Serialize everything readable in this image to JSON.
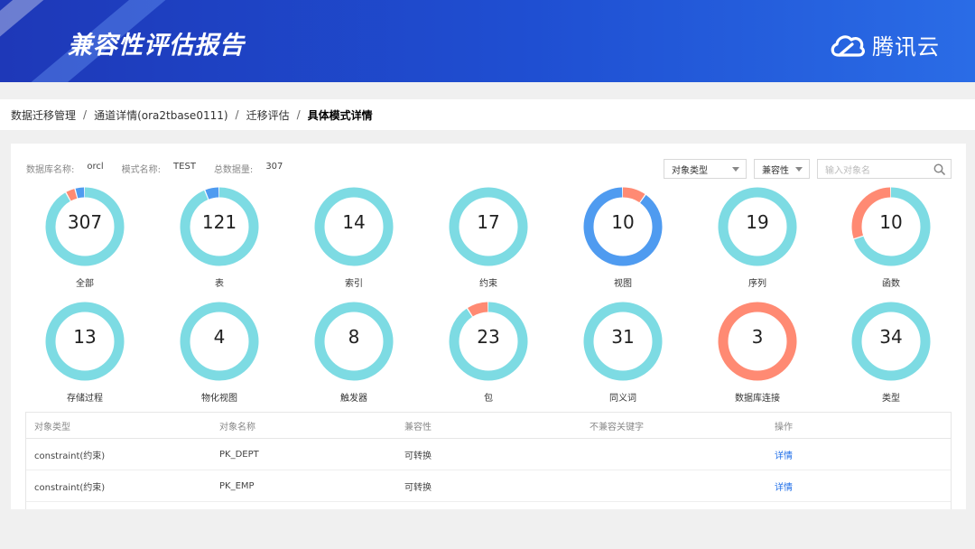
{
  "header": {
    "title": "兼容性评估报告",
    "brand": "腾讯云"
  },
  "breadcrumb": {
    "items": [
      "数据迁移管理",
      "通道详情(ora2tbase0111)",
      "迁移评估"
    ],
    "current": "具体模式详情",
    "separator": "/"
  },
  "meta": {
    "db_label": "数据库名称:",
    "db_value": "orcl",
    "schema_label": "模式名称:",
    "schema_value": "TEST",
    "total_label": "总数据量:",
    "total_value": "307"
  },
  "filters": {
    "object_type": "对象类型",
    "compat": "兼容性",
    "search_placeholder": "输入对象名"
  },
  "colors": {
    "ok": "#7ddbe3",
    "warn": "#ff8a73",
    "info": "#4f9bf0"
  },
  "categories": [
    {
      "label": "全部",
      "count": "307",
      "segments": [
        0.92,
        0.04,
        0.04
      ],
      "order": [
        "ok",
        "warn",
        "info"
      ]
    },
    {
      "label": "表",
      "count": "121",
      "segments": [
        0.94,
        0.0,
        0.06
      ],
      "order": [
        "ok",
        "warn",
        "info"
      ]
    },
    {
      "label": "索引",
      "count": "14",
      "segments": [
        1.0,
        0.0,
        0.0
      ],
      "order": [
        "ok",
        "warn",
        "info"
      ]
    },
    {
      "label": "约束",
      "count": "17",
      "segments": [
        1.0,
        0.0,
        0.0
      ],
      "order": [
        "ok",
        "warn",
        "info"
      ]
    },
    {
      "label": "视图",
      "count": "10",
      "segments": [
        0.0,
        0.1,
        0.9
      ],
      "order": [
        "ok",
        "warn",
        "info"
      ]
    },
    {
      "label": "序列",
      "count": "19",
      "segments": [
        1.0,
        0.0,
        0.0
      ],
      "order": [
        "ok",
        "warn",
        "info"
      ]
    },
    {
      "label": "函数",
      "count": "10",
      "segments": [
        0.7,
        0.3,
        0.0
      ],
      "order": [
        "ok",
        "warn",
        "info"
      ]
    },
    {
      "label": "存储过程",
      "count": "13",
      "segments": [
        1.0,
        0.0,
        0.0
      ],
      "order": [
        "ok",
        "warn",
        "info"
      ]
    },
    {
      "label": "物化视图",
      "count": "4",
      "segments": [
        1.0,
        0.0,
        0.0
      ],
      "order": [
        "ok",
        "warn",
        "info"
      ]
    },
    {
      "label": "触发器",
      "count": "8",
      "segments": [
        1.0,
        0.0,
        0.0
      ],
      "order": [
        "ok",
        "warn",
        "info"
      ]
    },
    {
      "label": "包",
      "count": "23",
      "segments": [
        0.91,
        0.09,
        0.0
      ],
      "order": [
        "ok",
        "warn",
        "info"
      ]
    },
    {
      "label": "同义词",
      "count": "31",
      "segments": [
        1.0,
        0.0,
        0.0
      ],
      "order": [
        "ok",
        "warn",
        "info"
      ]
    },
    {
      "label": "数据库连接",
      "count": "3",
      "segments": [
        0.0,
        1.0,
        0.0
      ],
      "order": [
        "ok",
        "warn",
        "info"
      ]
    },
    {
      "label": "类型",
      "count": "34",
      "segments": [
        1.0,
        0.0,
        0.0
      ],
      "order": [
        "ok",
        "warn",
        "info"
      ]
    }
  ],
  "table": {
    "headers": [
      "对象类型",
      "对象名称",
      "兼容性",
      "不兼容关键字",
      "操作"
    ],
    "rows": [
      [
        "constraint(约束)",
        "PK_DEPT",
        "可转换",
        "",
        "详情"
      ],
      [
        "constraint(约束)",
        "PK_EMP",
        "可转换",
        "",
        "详情"
      ]
    ]
  }
}
